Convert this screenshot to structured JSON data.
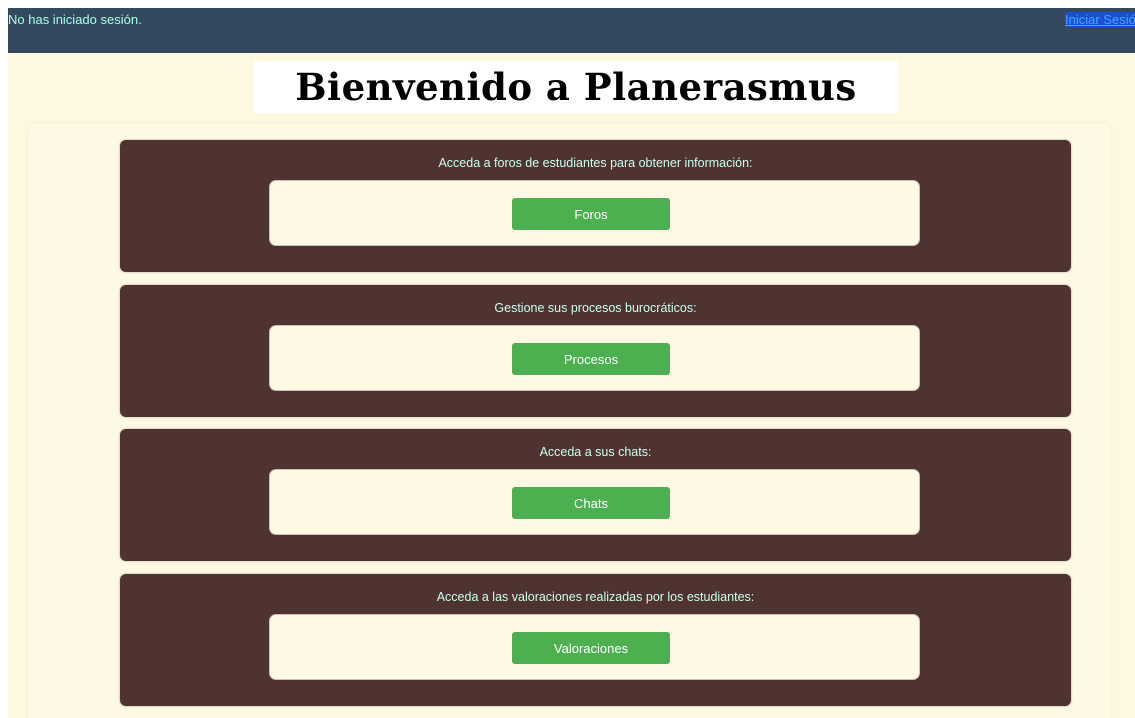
{
  "header": {
    "session_status": "No has iniciado sesión.",
    "login_link": "Iniciar Sesión"
  },
  "banner": {
    "title": "Bienvenido a Planerasmus"
  },
  "sections": [
    {
      "description": "Acceda a foros de estudiantes para obtener información:",
      "button": "Foros"
    },
    {
      "description": "Gestione sus procesos burocráticos:",
      "button": "Procesos"
    },
    {
      "description": "Acceda a sus chats:",
      "button": "Chats"
    },
    {
      "description": "Acceda a las valoraciones realizadas por los estudiantes:",
      "button": "Valoraciones"
    }
  ],
  "colors": {
    "header_bg": "#34495e",
    "page_bg": "#fff8e1",
    "card_bg": "#4e3330",
    "button_bg": "#4caf50",
    "accent_text": "#c9ffef"
  }
}
